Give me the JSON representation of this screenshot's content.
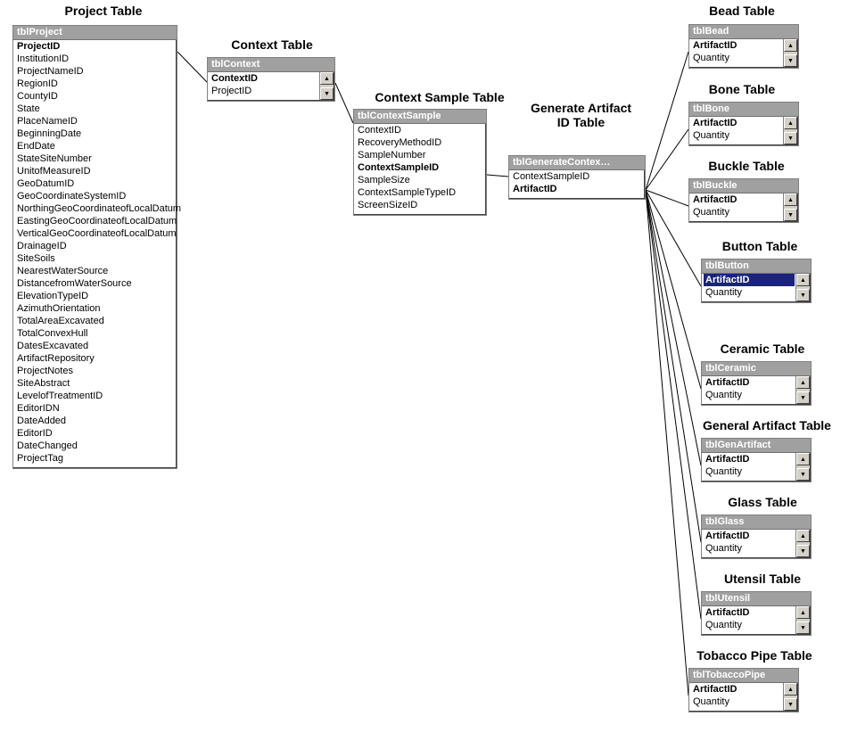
{
  "titles": {
    "project": "Project Table",
    "context": "Context Table",
    "contextSample": "Context Sample Table",
    "generate": "Generate Artifact ID Table",
    "bead": "Bead Table",
    "bone": "Bone Table",
    "buckle": "Buckle Table",
    "button": "Button Table",
    "ceramic": "Ceramic Table",
    "genArtifact": "General Artifact Table",
    "glass": "Glass Table",
    "utensil": "Utensil Table",
    "tobacco": "Tobacco Pipe Table"
  },
  "project": {
    "header": "tblProject",
    "fields": [
      {
        "name": "ProjectID",
        "pk": true
      },
      {
        "name": "InstitutionID"
      },
      {
        "name": "ProjectNameID"
      },
      {
        "name": "RegionID"
      },
      {
        "name": "CountyID"
      },
      {
        "name": "State"
      },
      {
        "name": "PlaceNameID"
      },
      {
        "name": "BeginningDate"
      },
      {
        "name": "EndDate"
      },
      {
        "name": "StateSiteNumber"
      },
      {
        "name": "UnitofMeasureID"
      },
      {
        "name": "GeoDatumID"
      },
      {
        "name": "GeoCoordinateSystemID"
      },
      {
        "name": "NorthingGeoCoordinateofLocalDatum"
      },
      {
        "name": "EastingGeoCoordinateofLocalDatum"
      },
      {
        "name": "VerticalGeoCoordinateofLocalDatum"
      },
      {
        "name": "DrainageID"
      },
      {
        "name": "SiteSoils"
      },
      {
        "name": "NearestWaterSource"
      },
      {
        "name": "DistancefromWaterSource"
      },
      {
        "name": "ElevationTypeID"
      },
      {
        "name": "AzimuthOrientation"
      },
      {
        "name": "TotalAreaExcavated"
      },
      {
        "name": "TotalConvexHull"
      },
      {
        "name": "DatesExcavated"
      },
      {
        "name": "ArtifactRepository"
      },
      {
        "name": "ProjectNotes"
      },
      {
        "name": "SiteAbstract"
      },
      {
        "name": "LevelofTreatmentID"
      },
      {
        "name": "EditorIDN"
      },
      {
        "name": "DateAdded"
      },
      {
        "name": "EditorID"
      },
      {
        "name": "DateChanged"
      },
      {
        "name": "ProjectTag"
      }
    ]
  },
  "context": {
    "header": "tblContext",
    "fields": [
      {
        "name": "ContextID",
        "pk": true
      },
      {
        "name": "ProjectID"
      }
    ]
  },
  "contextSample": {
    "header": "tblContextSample",
    "fields": [
      {
        "name": "ContextID"
      },
      {
        "name": "RecoveryMethodID"
      },
      {
        "name": "SampleNumber"
      },
      {
        "name": "ContextSampleID",
        "pk": true
      },
      {
        "name": "SampleSize"
      },
      {
        "name": "ContextSampleTypeID"
      },
      {
        "name": "ScreenSizeID"
      }
    ]
  },
  "generate": {
    "header": "tblGenerateContex…",
    "fields": [
      {
        "name": "ContextSampleID"
      },
      {
        "name": "ArtifactID",
        "pk": true
      }
    ]
  },
  "artifactTables": {
    "bead": {
      "header": "tblBead",
      "fields": [
        {
          "name": "ArtifactID",
          "pk": true
        },
        {
          "name": "Quantity"
        }
      ]
    },
    "bone": {
      "header": "tblBone",
      "fields": [
        {
          "name": "ArtifactID",
          "pk": true
        },
        {
          "name": "Quantity"
        }
      ]
    },
    "buckle": {
      "header": "tblBuckle",
      "fields": [
        {
          "name": "ArtifactID",
          "pk": true
        },
        {
          "name": "Quantity"
        }
      ]
    },
    "button": {
      "header": "tblButton",
      "fields": [
        {
          "name": "ArtifactID",
          "pk": true,
          "sel": true
        },
        {
          "name": "Quantity"
        }
      ]
    },
    "ceramic": {
      "header": "tblCeramic",
      "fields": [
        {
          "name": "ArtifactID",
          "pk": true
        },
        {
          "name": "Quantity"
        }
      ]
    },
    "genArtifact": {
      "header": "tblGenArtifact",
      "fields": [
        {
          "name": "ArtifactID",
          "pk": true
        },
        {
          "name": "Quantity"
        }
      ]
    },
    "glass": {
      "header": "tblGlass",
      "fields": [
        {
          "name": "ArtifactID",
          "pk": true
        },
        {
          "name": "Quantity"
        }
      ]
    },
    "utensil": {
      "header": "tblUtensil",
      "fields": [
        {
          "name": "ArtifactID",
          "pk": true
        },
        {
          "name": "Quantity"
        }
      ]
    },
    "tobacco": {
      "header": "tblTobaccoPipe",
      "fields": [
        {
          "name": "ArtifactID",
          "pk": true
        },
        {
          "name": "Quantity"
        }
      ]
    }
  },
  "arrows": {
    "up": "▲",
    "down": "▼"
  }
}
